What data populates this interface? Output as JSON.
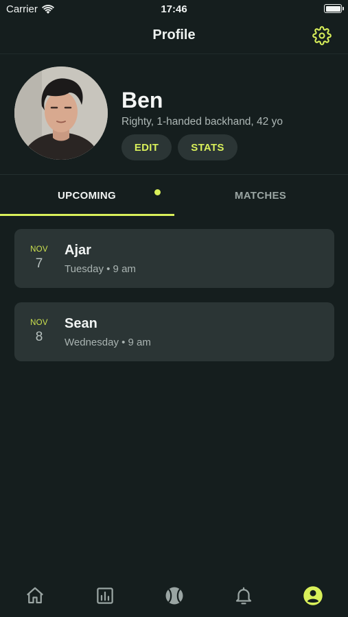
{
  "status_bar": {
    "carrier": "Carrier",
    "time": "17:46"
  },
  "nav": {
    "title": "Profile"
  },
  "profile": {
    "name": "Ben",
    "description": "Righty, 1-handed backhand, 42 yo",
    "edit_label": "EDIT",
    "stats_label": "STATS"
  },
  "tabs": {
    "upcoming": "UPCOMING",
    "matches": "MATCHES"
  },
  "matches": [
    {
      "month": "NOV",
      "day": "7",
      "name": "Ajar",
      "time": "Tuesday • 9 am"
    },
    {
      "month": "NOV",
      "day": "8",
      "name": "Sean",
      "time": "Wednesday • 9 am"
    }
  ],
  "bottom_tabs": [
    "home-icon",
    "stats-icon",
    "tennis-ball-icon",
    "bell-icon",
    "profile-icon"
  ],
  "colors": {
    "accent": "#d9f05a",
    "background": "#151e1e",
    "card": "#2b3535"
  }
}
